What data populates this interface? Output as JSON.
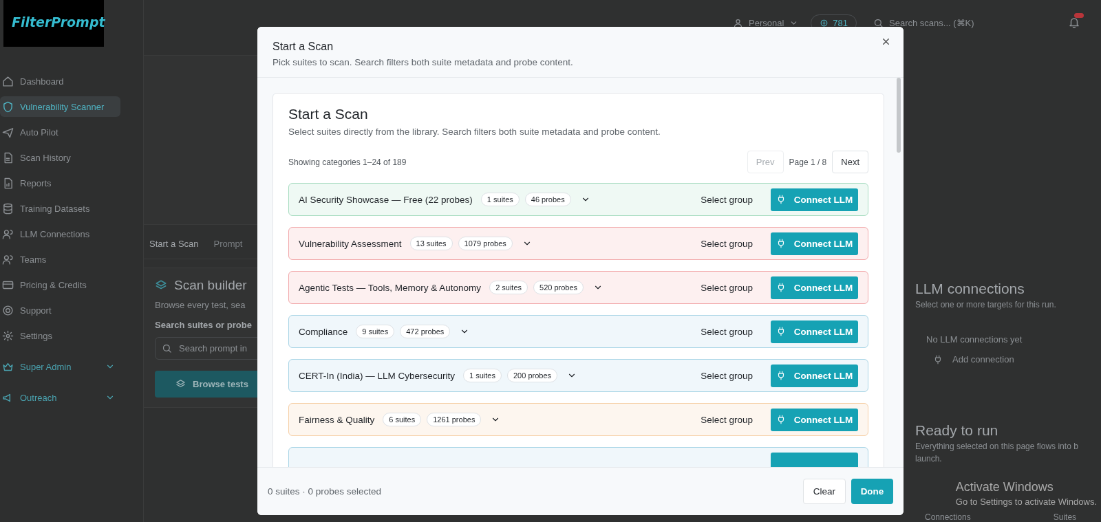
{
  "logo": {
    "text": "FilterPrompt"
  },
  "sidebar": {
    "items": [
      {
        "label": "Dashboard",
        "kind": "link",
        "selected": false
      },
      {
        "label": "Vulnerability Scanner",
        "kind": "link",
        "selected": true
      },
      {
        "label": "Auto Pilot",
        "kind": "link",
        "selected": false
      },
      {
        "label": "Scan History",
        "kind": "link",
        "selected": false
      },
      {
        "label": "Reports",
        "kind": "link",
        "selected": false
      },
      {
        "label": "Training Datasets",
        "kind": "link",
        "selected": false
      },
      {
        "label": "LLM Connections",
        "kind": "link",
        "selected": false
      },
      {
        "label": "Teams",
        "kind": "link",
        "selected": false
      },
      {
        "label": "Pricing & Credits",
        "kind": "link",
        "selected": false
      },
      {
        "label": "Support",
        "kind": "link",
        "selected": false
      },
      {
        "label": "Settings",
        "kind": "link",
        "selected": false
      },
      {
        "label": "Super Admin",
        "kind": "group",
        "selected": false,
        "expanded": false
      },
      {
        "label": "Outreach",
        "kind": "group",
        "selected": false,
        "expanded": false
      }
    ]
  },
  "topbar": {
    "workspace": "Personal",
    "credits": "781",
    "search": {
      "placeholder": "Search scans... (⌘K)"
    }
  },
  "tabs": [
    {
      "label": "Start a Scan",
      "selected": true
    },
    {
      "label": "Prompt",
      "selected": false
    }
  ],
  "scan_builder": {
    "title": "Scan builder",
    "description": "Browse every test, sea",
    "search_label": "Search suites or probe",
    "search": {
      "placeholder": "Search prompt in"
    },
    "browse_button": "Browse tests"
  },
  "llm_connections": {
    "title": "LLM connections",
    "description": "Select one or more targets for this run.",
    "empty_text": "No LLM connections yet",
    "add_button": "Add connection"
  },
  "ready": {
    "title": "Ready to run",
    "description_lines": [
      "Everything selected on this page flows into b",
      "launch."
    ],
    "stat_labels": [
      "Connections",
      "Suites"
    ]
  },
  "modal": {
    "title": "Start a Scan",
    "subtitle": "Pick suites to scan. Search filters both suite metadata and probe content.",
    "card_title": "Start a Scan",
    "card_description": "Select suites directly from the library. Search filters both suite metadata and probe content.",
    "showing": "Showing categories 1–24 of 189",
    "prev": {
      "label": "Prev",
      "disabled": true
    },
    "page": "Page 1 / 8",
    "next": {
      "label": "Next",
      "disabled": false
    },
    "groups": [
      {
        "name": "AI Security Showcase — Free (22 probes)",
        "suites": "1 suites",
        "probes": "46 probes",
        "expanded": false,
        "select_label": "Select group",
        "action": "Connect LLM",
        "color": "#a8dcc1"
      },
      {
        "name": "Vulnerability Assessment",
        "suites": "13 suites",
        "probes": "1079 probes",
        "expanded": false,
        "select_label": "Select group",
        "action": "Connect LLM",
        "color": "#f2a9ab"
      },
      {
        "name": "Agentic Tests — Tools, Memory & Autonomy",
        "suites": "2 suites",
        "probes": "520 probes",
        "expanded": false,
        "select_label": "Select group",
        "action": "Connect LLM",
        "color": "#f2a9ab"
      },
      {
        "name": "Compliance",
        "suites": "9 suites",
        "probes": "472 probes",
        "expanded": false,
        "select_label": "Select group",
        "action": "Connect LLM",
        "color": "#a9d5e6"
      },
      {
        "name": "CERT-In (India) — LLM Cybersecurity",
        "suites": "1 suites",
        "probes": "200 probes",
        "expanded": false,
        "select_label": "Select group",
        "action": "Connect LLM",
        "color": "#a9d5e6"
      },
      {
        "name": "Fairness & Quality",
        "suites": "6 suites",
        "probes": "1261 probes",
        "expanded": false,
        "select_label": "Select group",
        "action": "Connect LLM",
        "color": "#f6cfa6"
      },
      {
        "color": "#a9d5e6"
      }
    ],
    "selection_summary": "0 suites · 0 probes selected",
    "clear_button": "Clear",
    "done_button": "Done"
  },
  "os_notice": {
    "title": "Activate Windows",
    "subtitle": "Go to Settings to activate Windows."
  }
}
